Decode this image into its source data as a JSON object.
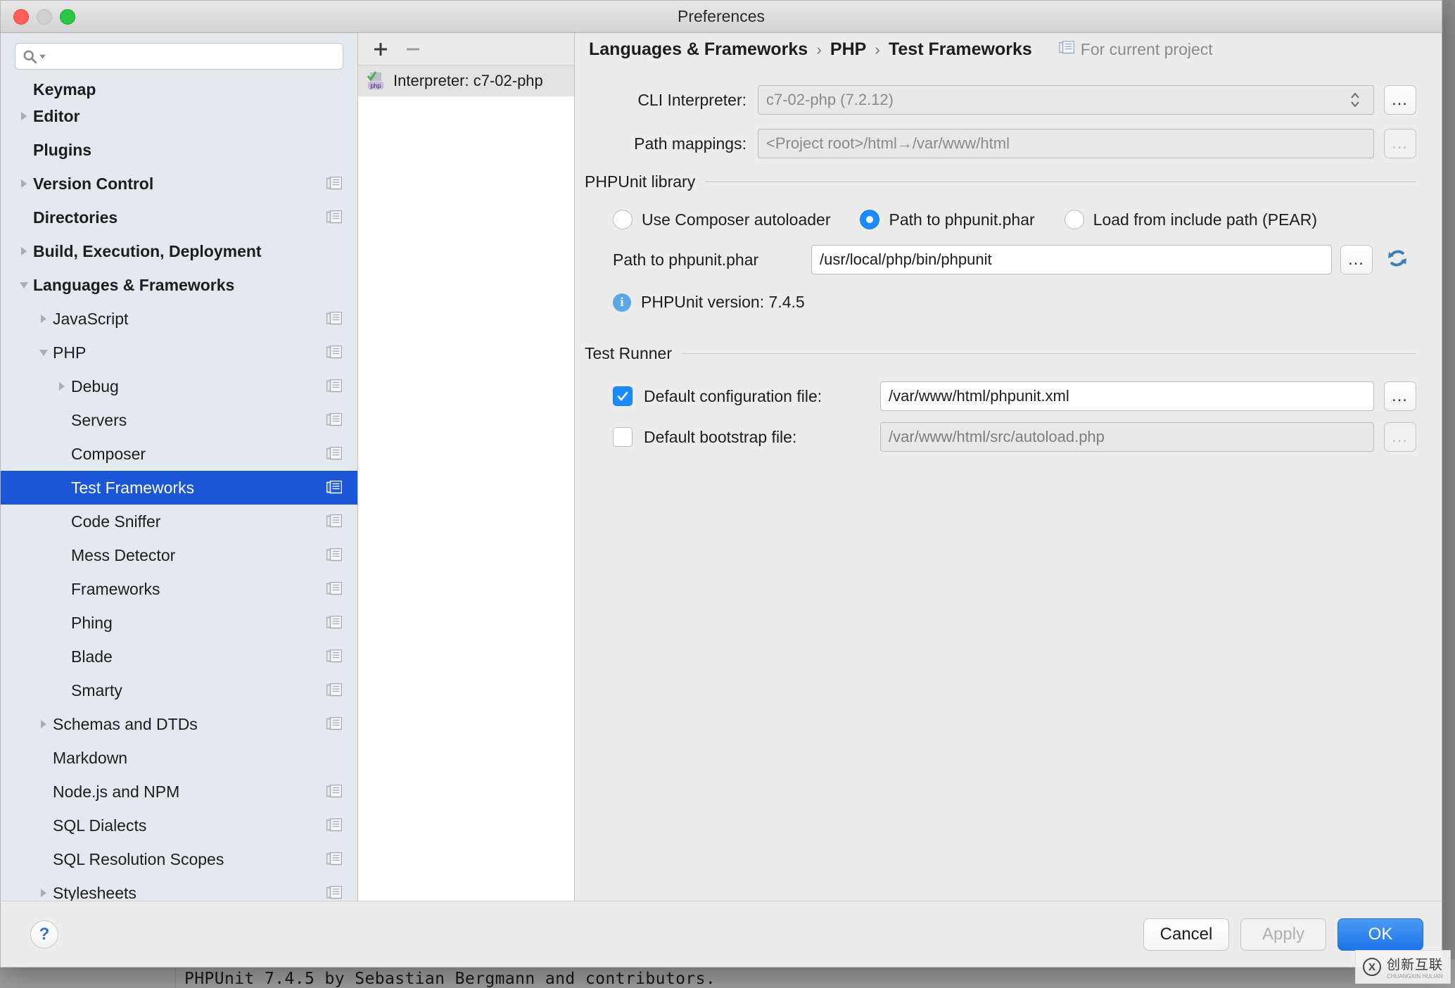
{
  "window": {
    "title": "Preferences"
  },
  "search": {
    "value": "",
    "placeholder": ""
  },
  "sidebar": {
    "items": [
      {
        "label": "Keymap",
        "level": 0,
        "bold": true,
        "twist": "none",
        "copy": false,
        "clipped": true
      },
      {
        "label": "Editor",
        "level": 0,
        "bold": true,
        "twist": "collapsed",
        "copy": false
      },
      {
        "label": "Plugins",
        "level": 0,
        "bold": true,
        "twist": "none",
        "copy": false
      },
      {
        "label": "Version Control",
        "level": 0,
        "bold": true,
        "twist": "collapsed",
        "copy": true
      },
      {
        "label": "Directories",
        "level": 0,
        "bold": true,
        "twist": "none",
        "copy": true
      },
      {
        "label": "Build, Execution, Deployment",
        "level": 0,
        "bold": true,
        "twist": "collapsed",
        "copy": false
      },
      {
        "label": "Languages & Frameworks",
        "level": 0,
        "bold": true,
        "twist": "expanded",
        "copy": false
      },
      {
        "label": "JavaScript",
        "level": 1,
        "bold": false,
        "twist": "collapsed",
        "copy": true
      },
      {
        "label": "PHP",
        "level": 1,
        "bold": false,
        "twist": "expanded",
        "copy": true
      },
      {
        "label": "Debug",
        "level": 2,
        "bold": false,
        "twist": "collapsed",
        "copy": true
      },
      {
        "label": "Servers",
        "level": 2,
        "bold": false,
        "twist": "none",
        "copy": true
      },
      {
        "label": "Composer",
        "level": 2,
        "bold": false,
        "twist": "none",
        "copy": true
      },
      {
        "label": "Test Frameworks",
        "level": 2,
        "bold": false,
        "twist": "none",
        "copy": true,
        "selected": true
      },
      {
        "label": "Code Sniffer",
        "level": 2,
        "bold": false,
        "twist": "none",
        "copy": true
      },
      {
        "label": "Mess Detector",
        "level": 2,
        "bold": false,
        "twist": "none",
        "copy": true
      },
      {
        "label": "Frameworks",
        "level": 2,
        "bold": false,
        "twist": "none",
        "copy": true
      },
      {
        "label": "Phing",
        "level": 2,
        "bold": false,
        "twist": "none",
        "copy": true
      },
      {
        "label": "Blade",
        "level": 2,
        "bold": false,
        "twist": "none",
        "copy": true
      },
      {
        "label": "Smarty",
        "level": 2,
        "bold": false,
        "twist": "none",
        "copy": true
      },
      {
        "label": "Schemas and DTDs",
        "level": 1,
        "bold": false,
        "twist": "collapsed",
        "copy": true
      },
      {
        "label": "Markdown",
        "level": 1,
        "bold": false,
        "twist": "none",
        "copy": false
      },
      {
        "label": "Node.js and NPM",
        "level": 1,
        "bold": false,
        "twist": "none",
        "copy": true
      },
      {
        "label": "SQL Dialects",
        "level": 1,
        "bold": false,
        "twist": "none",
        "copy": true
      },
      {
        "label": "SQL Resolution Scopes",
        "level": 1,
        "bold": false,
        "twist": "none",
        "copy": true
      },
      {
        "label": "Stylesheets",
        "level": 1,
        "bold": false,
        "twist": "collapsed",
        "copy": true
      }
    ]
  },
  "middle": {
    "add_label": "+",
    "remove_label": "–",
    "items": [
      {
        "label": "Interpreter: c7-02-php",
        "icon": "php-checked-icon"
      }
    ]
  },
  "breadcrumb": {
    "parts": [
      "Languages & Frameworks",
      "PHP",
      "Test Frameworks"
    ],
    "separator": "›",
    "scope_label": "For current project"
  },
  "form": {
    "cli_interpreter": {
      "label": "CLI Interpreter:",
      "value": "c7-02-php (7.2.12)",
      "browse_label": "…"
    },
    "path_mappings": {
      "label": "Path mappings:",
      "value": "<Project root>/html→/var/www/html",
      "browse_label": "…"
    }
  },
  "phpunit_library": {
    "title": "PHPUnit library",
    "options": [
      {
        "label": "Use Composer autoloader",
        "checked": false
      },
      {
        "label": "Path to phpunit.phar",
        "checked": true
      },
      {
        "label": "Load from include path (PEAR)",
        "checked": false
      }
    ],
    "phar_path": {
      "label": "Path to phpunit.phar",
      "value": "/usr/local/php/bin/phpunit",
      "browse_label": "…",
      "refresh_icon": "refresh-icon"
    },
    "version_info": "PHPUnit version: 7.4.5"
  },
  "test_runner": {
    "title": "Test Runner",
    "rows": [
      {
        "label": "Default configuration file:",
        "checked": true,
        "value": "/var/www/html/phpunit.xml",
        "disabled": false,
        "browse_label": "…"
      },
      {
        "label": "Default bootstrap file:",
        "checked": false,
        "value": "/var/www/html/src/autoload.php",
        "disabled": true,
        "browse_label": "…"
      }
    ]
  },
  "footer": {
    "help_label": "?",
    "cancel_label": "Cancel",
    "apply_label": "Apply",
    "ok_label": "OK"
  },
  "background": {
    "console_text": "PHPUnit 7.4.5 by Sebastian Bergmann and contributors."
  },
  "watermark": {
    "mark": "X",
    "text": "创新互联",
    "sub": "CHUANGXIN HULIAN"
  },
  "colors": {
    "accent": "#1a56d6",
    "radio_blue": "#1a8cff",
    "ok_blue": "#1e73e8",
    "sidebar_bg": "#e4e9ee",
    "dialog_bg": "#ececec"
  }
}
